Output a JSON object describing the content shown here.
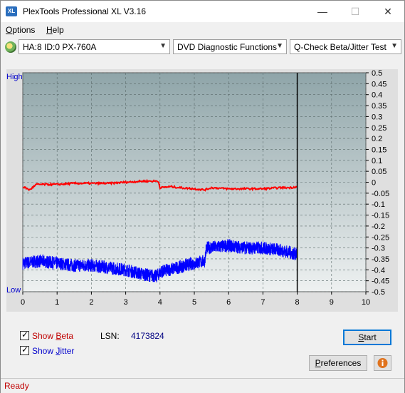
{
  "window": {
    "title": "PlexTools Professional XL V3.16",
    "app_icon_text": "XL",
    "minimize": "—",
    "maximize": "☐",
    "close": "✕"
  },
  "menu": {
    "options": "Options",
    "options_key": "O",
    "options_rest": "ptions",
    "help": "Help",
    "help_key": "H",
    "help_rest": "elp"
  },
  "toolbar": {
    "drive": "HA:8 ID:0  PX-760A",
    "function": "DVD Diagnostic Functions",
    "test": "Q-Check Beta/Jitter Test"
  },
  "chart_data": {
    "type": "line",
    "left_axis_labels": {
      "top": "High",
      "bottom": "Low"
    },
    "x_ticks": [
      "0",
      "1",
      "2",
      "3",
      "4",
      "5",
      "6",
      "7",
      "8",
      "9",
      "10"
    ],
    "xlim": [
      0,
      10
    ],
    "y_ticks": [
      "0.5",
      "0.45",
      "0.4",
      "0.35",
      "0.3",
      "0.25",
      "0.2",
      "0.15",
      "0.1",
      "0.05",
      "0",
      "-0.05",
      "-0.1",
      "-0.15",
      "-0.2",
      "-0.25",
      "-0.3",
      "-0.35",
      "-0.4",
      "-0.45",
      "-0.5"
    ],
    "ylim": [
      -0.5,
      0.5
    ],
    "grid": true,
    "end_marker_x": 8,
    "series": [
      {
        "color": "#ff0000",
        "x": [
          0,
          0.2,
          0.4,
          1,
          1.5,
          2,
          2.5,
          3,
          3.5,
          3.8,
          3.95,
          4.0,
          4.3,
          4.6,
          5.0,
          5.3,
          5.5,
          6,
          6.5,
          7,
          7.5,
          7.8,
          8.0
        ],
        "y": [
          -0.02,
          -0.035,
          -0.01,
          -0.01,
          -0.005,
          -0.005,
          -0.005,
          0,
          0.005,
          0.005,
          0.005,
          -0.025,
          -0.02,
          -0.025,
          -0.03,
          -0.035,
          -0.025,
          -0.03,
          -0.03,
          -0.03,
          -0.025,
          -0.025,
          -0.02
        ]
      },
      {
        "color": "#0000ff",
        "x": [
          0,
          0.5,
          1,
          1.5,
          2,
          2.5,
          3,
          3.5,
          3.9,
          4.0,
          4.5,
          5.0,
          5.3,
          5.35,
          6,
          6.5,
          7,
          7.5,
          8.0
        ],
        "y": [
          -0.37,
          -0.36,
          -0.37,
          -0.38,
          -0.38,
          -0.39,
          -0.4,
          -0.42,
          -0.43,
          -0.41,
          -0.39,
          -0.37,
          -0.36,
          -0.3,
          -0.29,
          -0.3,
          -0.3,
          -0.31,
          -0.33
        ]
      }
    ]
  },
  "bottom": {
    "show_beta": "Show Beta",
    "show_beta_pre": "Show ",
    "show_beta_key": "B",
    "show_beta_rest": "eta",
    "show_jitter": "Show Jitter",
    "show_jitter_pre": "Show ",
    "show_jitter_key": "J",
    "show_jitter_rest": "itter",
    "show_beta_checked": true,
    "show_jitter_checked": true,
    "lsn_label": "LSN:",
    "lsn_value": "4173824",
    "start_button": "Start",
    "start_key": "S",
    "start_rest": "tart",
    "preferences_button": "Preferences",
    "pref_key": "P",
    "pref_rest": "references",
    "info_icon": "info-icon"
  },
  "status": {
    "text": "Ready"
  }
}
